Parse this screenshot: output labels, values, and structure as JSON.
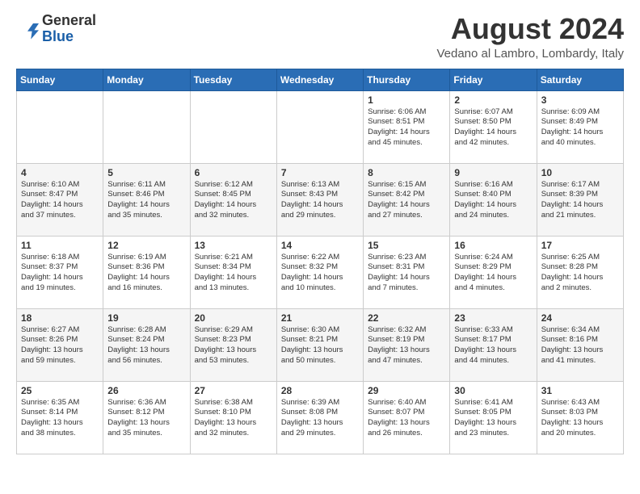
{
  "header": {
    "logo_line1": "General",
    "logo_line2": "Blue",
    "month_year": "August 2024",
    "location": "Vedano al Lambro, Lombardy, Italy"
  },
  "weekdays": [
    "Sunday",
    "Monday",
    "Tuesday",
    "Wednesday",
    "Thursday",
    "Friday",
    "Saturday"
  ],
  "weeks": [
    [
      {
        "day": "",
        "info": ""
      },
      {
        "day": "",
        "info": ""
      },
      {
        "day": "",
        "info": ""
      },
      {
        "day": "",
        "info": ""
      },
      {
        "day": "1",
        "info": "Sunrise: 6:06 AM\nSunset: 8:51 PM\nDaylight: 14 hours\nand 45 minutes."
      },
      {
        "day": "2",
        "info": "Sunrise: 6:07 AM\nSunset: 8:50 PM\nDaylight: 14 hours\nand 42 minutes."
      },
      {
        "day": "3",
        "info": "Sunrise: 6:09 AM\nSunset: 8:49 PM\nDaylight: 14 hours\nand 40 minutes."
      }
    ],
    [
      {
        "day": "4",
        "info": "Sunrise: 6:10 AM\nSunset: 8:47 PM\nDaylight: 14 hours\nand 37 minutes."
      },
      {
        "day": "5",
        "info": "Sunrise: 6:11 AM\nSunset: 8:46 PM\nDaylight: 14 hours\nand 35 minutes."
      },
      {
        "day": "6",
        "info": "Sunrise: 6:12 AM\nSunset: 8:45 PM\nDaylight: 14 hours\nand 32 minutes."
      },
      {
        "day": "7",
        "info": "Sunrise: 6:13 AM\nSunset: 8:43 PM\nDaylight: 14 hours\nand 29 minutes."
      },
      {
        "day": "8",
        "info": "Sunrise: 6:15 AM\nSunset: 8:42 PM\nDaylight: 14 hours\nand 27 minutes."
      },
      {
        "day": "9",
        "info": "Sunrise: 6:16 AM\nSunset: 8:40 PM\nDaylight: 14 hours\nand 24 minutes."
      },
      {
        "day": "10",
        "info": "Sunrise: 6:17 AM\nSunset: 8:39 PM\nDaylight: 14 hours\nand 21 minutes."
      }
    ],
    [
      {
        "day": "11",
        "info": "Sunrise: 6:18 AM\nSunset: 8:37 PM\nDaylight: 14 hours\nand 19 minutes."
      },
      {
        "day": "12",
        "info": "Sunrise: 6:19 AM\nSunset: 8:36 PM\nDaylight: 14 hours\nand 16 minutes."
      },
      {
        "day": "13",
        "info": "Sunrise: 6:21 AM\nSunset: 8:34 PM\nDaylight: 14 hours\nand 13 minutes."
      },
      {
        "day": "14",
        "info": "Sunrise: 6:22 AM\nSunset: 8:32 PM\nDaylight: 14 hours\nand 10 minutes."
      },
      {
        "day": "15",
        "info": "Sunrise: 6:23 AM\nSunset: 8:31 PM\nDaylight: 14 hours\nand 7 minutes."
      },
      {
        "day": "16",
        "info": "Sunrise: 6:24 AM\nSunset: 8:29 PM\nDaylight: 14 hours\nand 4 minutes."
      },
      {
        "day": "17",
        "info": "Sunrise: 6:25 AM\nSunset: 8:28 PM\nDaylight: 14 hours\nand 2 minutes."
      }
    ],
    [
      {
        "day": "18",
        "info": "Sunrise: 6:27 AM\nSunset: 8:26 PM\nDaylight: 13 hours\nand 59 minutes."
      },
      {
        "day": "19",
        "info": "Sunrise: 6:28 AM\nSunset: 8:24 PM\nDaylight: 13 hours\nand 56 minutes."
      },
      {
        "day": "20",
        "info": "Sunrise: 6:29 AM\nSunset: 8:23 PM\nDaylight: 13 hours\nand 53 minutes."
      },
      {
        "day": "21",
        "info": "Sunrise: 6:30 AM\nSunset: 8:21 PM\nDaylight: 13 hours\nand 50 minutes."
      },
      {
        "day": "22",
        "info": "Sunrise: 6:32 AM\nSunset: 8:19 PM\nDaylight: 13 hours\nand 47 minutes."
      },
      {
        "day": "23",
        "info": "Sunrise: 6:33 AM\nSunset: 8:17 PM\nDaylight: 13 hours\nand 44 minutes."
      },
      {
        "day": "24",
        "info": "Sunrise: 6:34 AM\nSunset: 8:16 PM\nDaylight: 13 hours\nand 41 minutes."
      }
    ],
    [
      {
        "day": "25",
        "info": "Sunrise: 6:35 AM\nSunset: 8:14 PM\nDaylight: 13 hours\nand 38 minutes."
      },
      {
        "day": "26",
        "info": "Sunrise: 6:36 AM\nSunset: 8:12 PM\nDaylight: 13 hours\nand 35 minutes."
      },
      {
        "day": "27",
        "info": "Sunrise: 6:38 AM\nSunset: 8:10 PM\nDaylight: 13 hours\nand 32 minutes."
      },
      {
        "day": "28",
        "info": "Sunrise: 6:39 AM\nSunset: 8:08 PM\nDaylight: 13 hours\nand 29 minutes."
      },
      {
        "day": "29",
        "info": "Sunrise: 6:40 AM\nSunset: 8:07 PM\nDaylight: 13 hours\nand 26 minutes."
      },
      {
        "day": "30",
        "info": "Sunrise: 6:41 AM\nSunset: 8:05 PM\nDaylight: 13 hours\nand 23 minutes."
      },
      {
        "day": "31",
        "info": "Sunrise: 6:43 AM\nSunset: 8:03 PM\nDaylight: 13 hours\nand 20 minutes."
      }
    ]
  ]
}
